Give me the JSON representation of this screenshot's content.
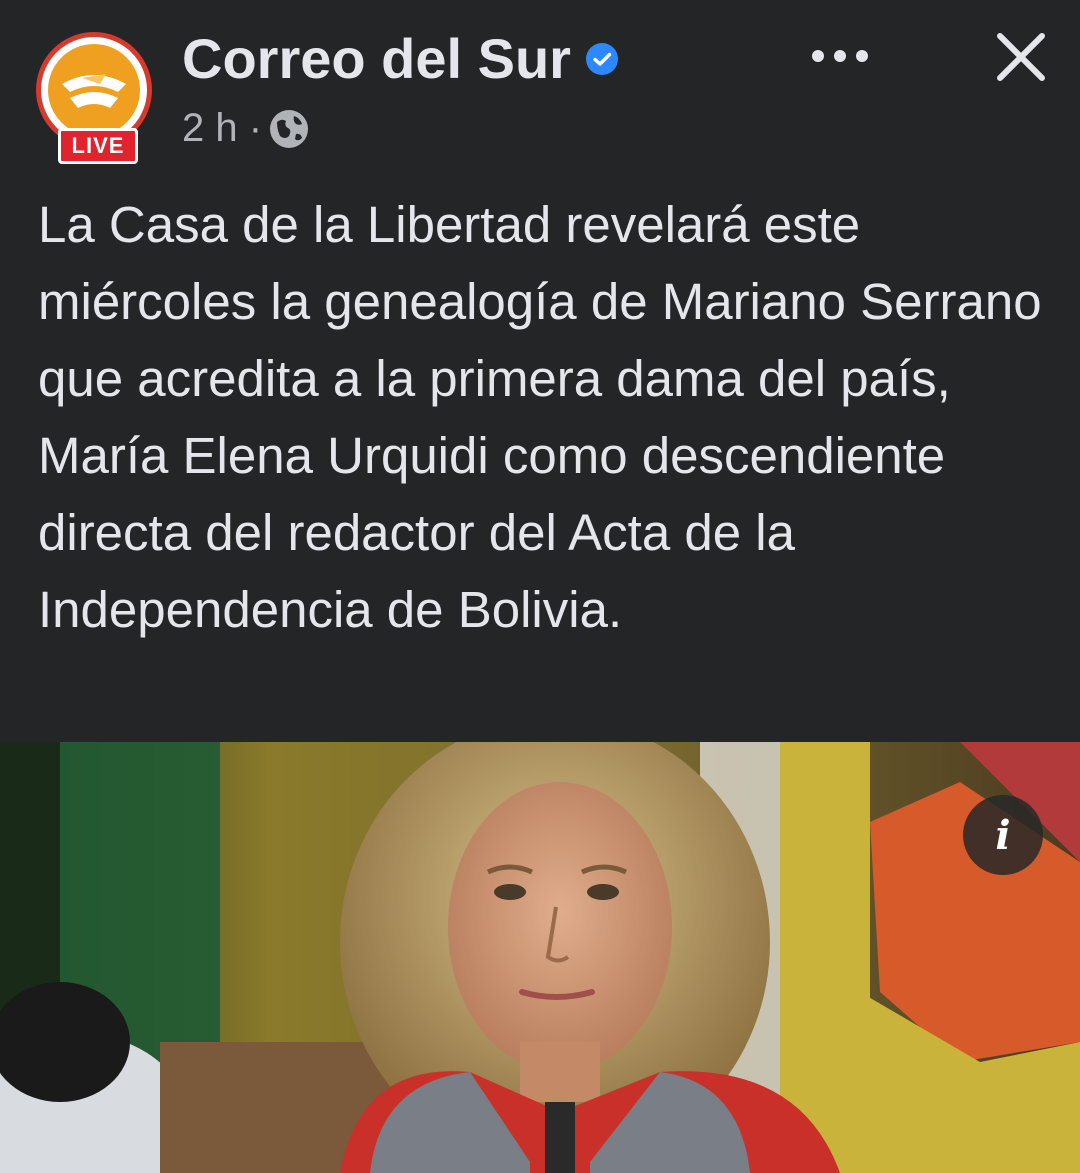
{
  "post": {
    "page_name": "Correo del Sur",
    "live_label": "LIVE",
    "time": "2 h ·",
    "text": "La Casa de la Libertad revelará este miércoles la genealogía de Mariano Serrano que acredita a la primera dama del país, María Elena Urquidi como descendiente directa del redactor del Acta de la Independencia de Bolivia.",
    "info_label": "i"
  },
  "icons": {
    "verified": "verified-badge-icon",
    "globe": "globe-icon",
    "more": "more-options-icon",
    "close": "close-icon"
  },
  "colors": {
    "background": "#242526",
    "text": "#e4e6eb",
    "secondary_text": "#b0b3b8",
    "verified": "#2d88ff",
    "live": "#e0242d",
    "logo": "#f0a020"
  }
}
